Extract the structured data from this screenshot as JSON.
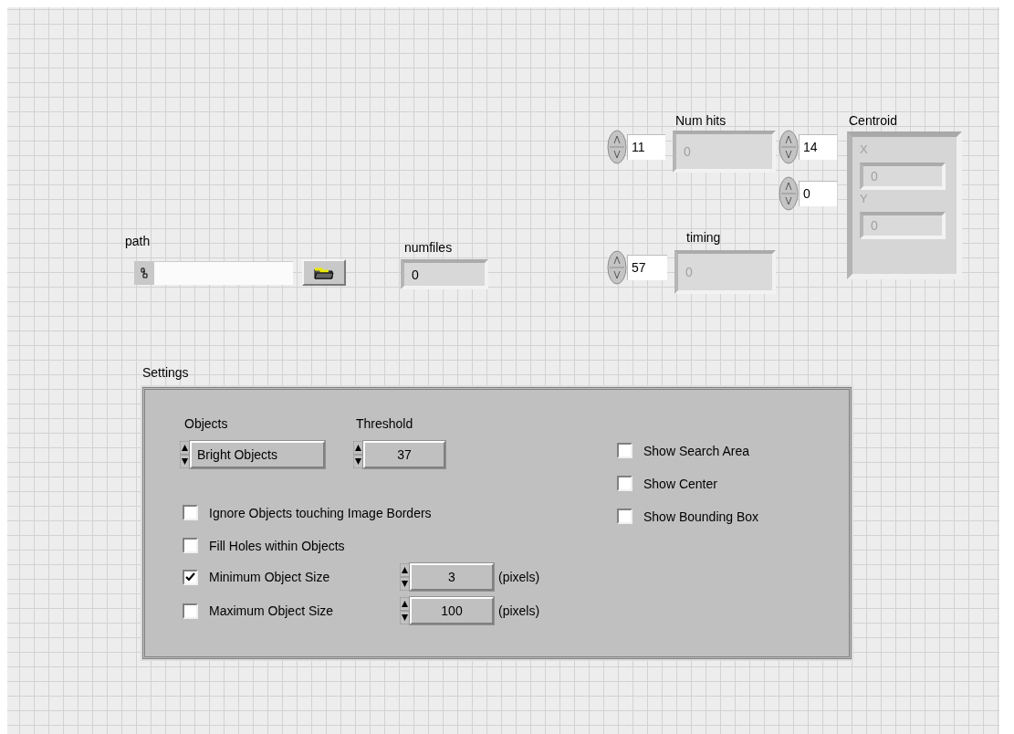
{
  "path": {
    "label": "path"
  },
  "numfiles": {
    "label": "numfiles",
    "value": "0"
  },
  "num_hits": {
    "label": "Num hits",
    "control": "11",
    "indicator": "0"
  },
  "centroid": {
    "label": "Centroid",
    "x_control": "14",
    "y_control": "0",
    "x_label": "X",
    "x_value": "0",
    "y_label": "Y",
    "y_value": "0"
  },
  "timing": {
    "label": "timing",
    "control": "57",
    "indicator": "0"
  },
  "settings": {
    "label": "Settings",
    "objects": {
      "label": "Objects",
      "value": "Bright Objects"
    },
    "threshold": {
      "label": "Threshold",
      "value": "37"
    },
    "options": [
      {
        "label": "Ignore Objects touching Image Borders",
        "checked": false
      },
      {
        "label": "Fill Holes within Objects",
        "checked": false
      }
    ],
    "size_options": [
      {
        "label": "Minimum Object Size",
        "checked": true,
        "value": "3",
        "unit": "(pixels)"
      },
      {
        "label": "Maximum Object Size",
        "checked": false,
        "value": "100",
        "unit": "(pixels)"
      }
    ],
    "display_options": [
      {
        "label": "Show Search Area",
        "checked": false
      },
      {
        "label": "Show Center",
        "checked": false
      },
      {
        "label": "Show Bounding Box",
        "checked": false
      }
    ]
  }
}
